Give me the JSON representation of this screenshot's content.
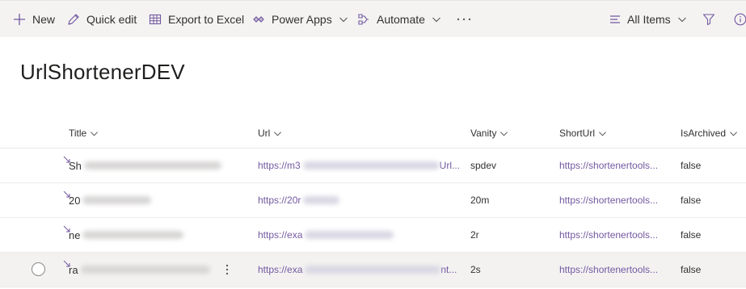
{
  "commandbar": {
    "new_label": "New",
    "quick_edit_label": "Quick edit",
    "export_label": "Export to Excel",
    "power_apps_label": "Power Apps",
    "automate_label": "Automate",
    "view_label": "All Items",
    "icons": {
      "new": "plus-icon",
      "quick_edit": "pencil-icon",
      "export": "excel-grid-icon",
      "power_apps": "power-apps-icon",
      "automate": "flow-icon",
      "more": "ellipsis-icon",
      "view": "lines-icon",
      "filter": "funnel-icon",
      "info": "info-icon"
    }
  },
  "page": {
    "title": "UrlShortenerDEV"
  },
  "list": {
    "columns": [
      {
        "key": "title",
        "label": "Title"
      },
      {
        "key": "url",
        "label": "Url"
      },
      {
        "key": "vanity",
        "label": "Vanity"
      },
      {
        "key": "shorturl",
        "label": "ShortUrl"
      },
      {
        "key": "isarchived",
        "label": "IsArchived"
      }
    ],
    "rows": [
      {
        "title": "Sh",
        "url": "https://m3",
        "url_tail": "Url...",
        "vanity": "spdev",
        "shorturl": "https://shortenertools...",
        "isarchived": "false",
        "selected": false
      },
      {
        "title": "20",
        "url": "https://20r",
        "url_tail": "",
        "vanity": "20m",
        "shorturl": "https://shortenertools...",
        "isarchived": "false",
        "selected": false
      },
      {
        "title": "ne",
        "url": "https://exa",
        "url_tail": "",
        "vanity": "2r",
        "shorturl": "https://shortenertools...",
        "isarchived": "false",
        "selected": false
      },
      {
        "title": "ra",
        "url": "https://exa",
        "url_tail": "nt...",
        "vanity": "2s",
        "shorturl": "https://shortenertools...",
        "isarchived": "false",
        "selected": true
      }
    ]
  },
  "colors": {
    "accent": "#7359a0",
    "commandbar_bg": "#f4f3f2",
    "selected_row_bg": "#f3f2f1",
    "text": "#323130"
  }
}
